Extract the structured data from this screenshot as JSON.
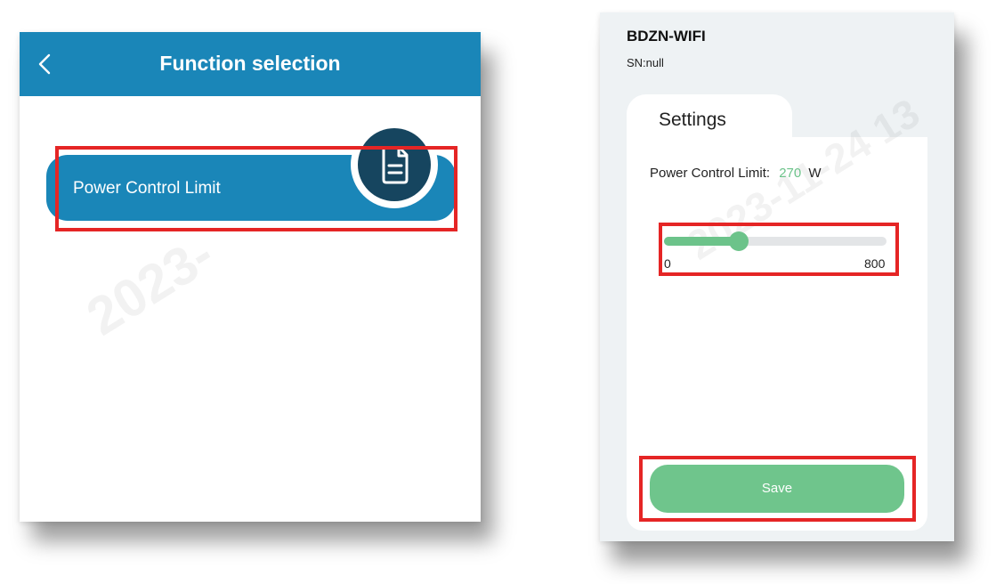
{
  "left_screen": {
    "title": "Function selection",
    "back_icon": "chevron-left-icon",
    "function_items": [
      {
        "label": "Power Control Limit",
        "icon": "document-icon"
      }
    ],
    "watermark": "2023-"
  },
  "right_screen": {
    "device_name": "BDZN-WIFI",
    "serial_number": "SN:null",
    "settings_tab_label": "Settings",
    "power_control_limit": {
      "label": "Power Control Limit:",
      "value": "270",
      "unit": "W",
      "min": "0",
      "max": "800",
      "fraction": 0.3375
    },
    "save_label": "Save",
    "watermark": "2023-11-24 13"
  },
  "colors": {
    "header_blue": "#1a86b8",
    "icon_dark": "#16455f",
    "accent_green": "#6cc38a",
    "highlight_red": "#e52525"
  }
}
